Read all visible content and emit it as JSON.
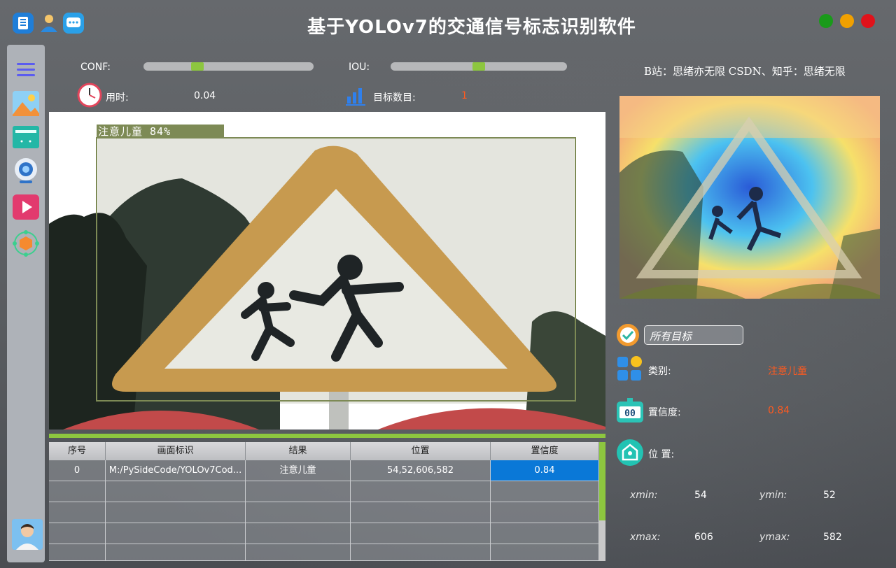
{
  "title_bar": {
    "title": "基于YOLOv7的交通信号标志识别软件",
    "icons": [
      "book-icon",
      "user-icon",
      "chat-icon"
    ],
    "window_controls": {
      "colors": [
        "#1a9a1a",
        "#f0a000",
        "#e0121a"
      ]
    }
  },
  "sidebar": {
    "items": [
      "menu-icon",
      "image-icon",
      "folder-icon",
      "camera-icon",
      "video-icon",
      "model-icon"
    ],
    "avatar": "avatar"
  },
  "controls": {
    "conf_label": "CONF:",
    "iou_label": "IOU:",
    "conf_value": 0.3,
    "iou_value": 0.5,
    "time_label": "用时:",
    "time_value": "0.04",
    "count_label": "目标数目:",
    "count_value": "1",
    "credit": "B站：思绪亦无限  CSDN、知乎：思绪无限"
  },
  "detection": {
    "box_label": "注意儿童 84%"
  },
  "table": {
    "headers": [
      "序号",
      "画面标识",
      "结果",
      "位置",
      "置信度"
    ],
    "rows": [
      [
        "0",
        "M:/PySideCode/YOLOv7Cod...",
        "注意儿童",
        "54,52,606,582",
        "0.84"
      ]
    ]
  },
  "info": {
    "select_value": "所有目标",
    "class_label": "类别:",
    "class_value": "注意儿童",
    "conf_label": "置信度:",
    "conf_value": "0.84",
    "pos_label": "位 置:",
    "xmin_label": "xmin:",
    "xmin": "54",
    "ymin_label": "ymin:",
    "ymin": "52",
    "xmax_label": "xmax:",
    "xmax": "606",
    "ymax_label": "ymax:",
    "ymax": "582"
  },
  "colors": {
    "accent_green": "#8dc63f",
    "value_orange": "#ff5a1f",
    "selected_cell": "#0a78d7"
  }
}
